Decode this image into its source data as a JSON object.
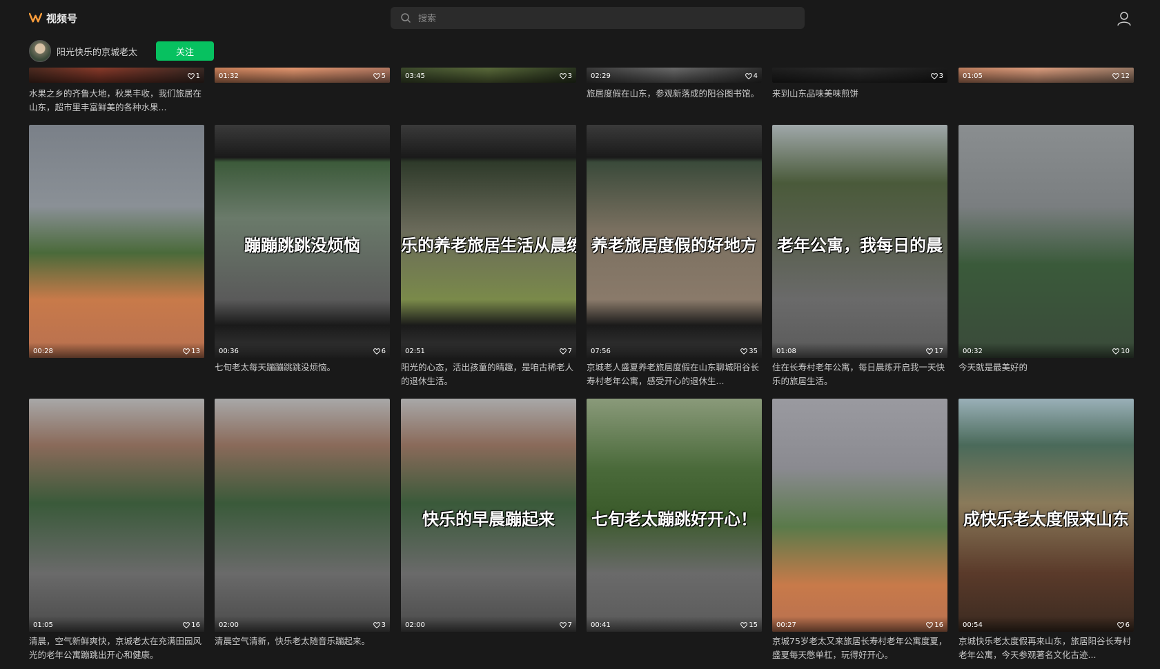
{
  "header": {
    "app_name": "视频号",
    "brand_color": "#fa9d3b",
    "search_placeholder": "搜索",
    "user_icon": "user-icon"
  },
  "author": {
    "name": "阳光快乐的京城老太",
    "follow_label": "关注",
    "follow_color": "#07c160"
  },
  "rows": [
    [
      {
        "duration": "",
        "likes": "1",
        "overlay": "",
        "caption": "水果之乡的齐鲁大地，秋果丰收，我们旅居在山东，超市里丰富鲜美的各种水果...",
        "bg": "linear-gradient(90deg,#4a2a20,#8a3a2a 40%,#3a2a25)"
      },
      {
        "duration": "01:32",
        "likes": "5",
        "overlay": "",
        "caption": "",
        "bg": "linear-gradient(90deg,#c9805a,#e69870 45%,#b57a63)"
      },
      {
        "duration": "03:45",
        "likes": "3",
        "overlay": "",
        "caption": "",
        "bg": "linear-gradient(90deg,#3c4a2c,#5a6a3a 50%,#2a3520)"
      },
      {
        "duration": "02:29",
        "likes": "4",
        "overlay": "",
        "caption": "旅居度假在山东，参观新落成的阳谷图书馆。",
        "bg": "linear-gradient(90deg,#3a3a3a,#6a6a6a 50%,#2f2f2f)"
      },
      {
        "duration": "",
        "likes": "3",
        "overlay": "",
        "caption": "来到山东品味美味煎饼",
        "bg": "linear-gradient(90deg,#1f1f1f,#2c2c2c 50%,#1a1a1a)"
      },
      {
        "duration": "01:05",
        "likes": "12",
        "overlay": "",
        "caption": "",
        "bg": "linear-gradient(90deg,#c08060,#e0a080 45%,#9a7a66)"
      }
    ],
    [
      {
        "duration": "00:28",
        "likes": "13",
        "overlay": "",
        "caption": "",
        "bg": "linear-gradient(180deg,#7a8088 0%,#8a9096 35%,#4a6a3a 55%,#c87a4a 75%,#b87050 100%)"
      },
      {
        "duration": "00:36",
        "likes": "6",
        "overlay": "蹦蹦跳跳没烦恼",
        "caption": "七旬老太每天蹦蹦跳跳没烦恼。",
        "bg": "linear-gradient(180deg,#3a3a3a 0%,#1a1a1a 14%,#3c5a3a 16%,#6a7a6a 40%,#5a5a5a 75%,#1a1a1a 86%,#3a3a3a 100%)"
      },
      {
        "duration": "02:51",
        "likes": "7",
        "overlay": "乐的养老旅居生活从晨练开",
        "caption": "阳光的心态，活出孩童的晴趣，是咱古稀老人的退休生活。",
        "bg": "linear-gradient(180deg,#3a3a3a 0%,#1a1a1a 14%,#2e3a2a 16%,#6a6a5a 45%,#7a8a4a 75%,#1a1a1a 86%,#3a3a3a 100%)"
      },
      {
        "duration": "07:56",
        "likes": "35",
        "overlay": "养老旅居度假的好地方",
        "caption": "京城老人盛夏养老旅居度假在山东聊城阳谷长寿村老年公寓，感受开心的退休生...",
        "bg": "linear-gradient(180deg,#3a3a3a 0%,#1a1a1a 14%,#3a4a3a 16%,#7a7060 45%,#8a7a6a 75%,#1a1a1a 86%,#3a3a3a 100%)"
      },
      {
        "duration": "01:08",
        "likes": "17",
        "overlay": "老年公寓，我每日的晨",
        "caption": "住在长寿村老年公寓，每日晨炼开启我一天快乐的旅居生活。",
        "bg": "linear-gradient(180deg,#a0a8aa 0%,#4a5a3a 25%,#5a6050 50%,#6a6a6a 75%,#5a5a5a 100%)"
      },
      {
        "duration": "00:32",
        "likes": "10",
        "overlay": "",
        "caption": "今天就是最美好的",
        "bg": "linear-gradient(180deg,#8a8e90 0%,#7a7e80 35%,#3a5a3a 60%,#3a4a3a 100%)"
      }
    ],
    [
      {
        "duration": "01:05",
        "likes": "16",
        "overlay": "",
        "caption": "清晨，空气新鲜爽快，京城老太在充满田园风光的老年公寓蹦跳出开心和健康。",
        "bg": "linear-gradient(180deg,#a8a8a8 0%,#8a6a5a 20%,#3a5a3a 45%,#6a6a6a 75%,#4a4a4a 100%)"
      },
      {
        "duration": "02:00",
        "likes": "3",
        "overlay": "",
        "caption": "清晨空气清新，快乐老太随音乐蹦起来。",
        "bg": "linear-gradient(180deg,#a8a8a8 0%,#8a6a5a 20%,#3a5a3a 45%,#6a6a6a 75%,#4a4a4a 100%)"
      },
      {
        "duration": "02:00",
        "likes": "7",
        "overlay": "快乐的早晨蹦起来",
        "caption": "",
        "bg": "linear-gradient(180deg,#a8a8a8 0%,#8a6a5a 20%,#3a5a3a 45%,#6a6a6a 75%,#4a4a4a 100%)"
      },
      {
        "duration": "00:41",
        "likes": "15",
        "overlay": "七旬老太蹦跳好开心！",
        "caption": "",
        "bg": "linear-gradient(180deg,#8a9a7a 0%,#4a6a3a 30%,#3a5a2a 50%,#6a6a6a 75%,#5a5a5a 100%)"
      },
      {
        "duration": "00:27",
        "likes": "16",
        "overlay": "",
        "caption": "京城75岁老太又来旅居长寿村老年公寓度夏，盛夏每天憋单杠，玩得好开心。",
        "bg": "linear-gradient(180deg,#9a9aa0 0%,#8a8a90 30%,#5a7a4a 55%,#c87a4a 80%,#b87050 100%)"
      },
      {
        "duration": "00:54",
        "likes": "6",
        "overlay": "成快乐老太度假来山东",
        "caption": "京城快乐老太度假再来山东，旅居阳谷长寿村老年公寓，今天参观著名文化古迹...",
        "bg": "linear-gradient(180deg,#9ab0b8 0%,#4a6a5a 20%,#8a7a5a 45%,#5a3a2a 75%,#3a2a20 100%)"
      }
    ]
  ]
}
